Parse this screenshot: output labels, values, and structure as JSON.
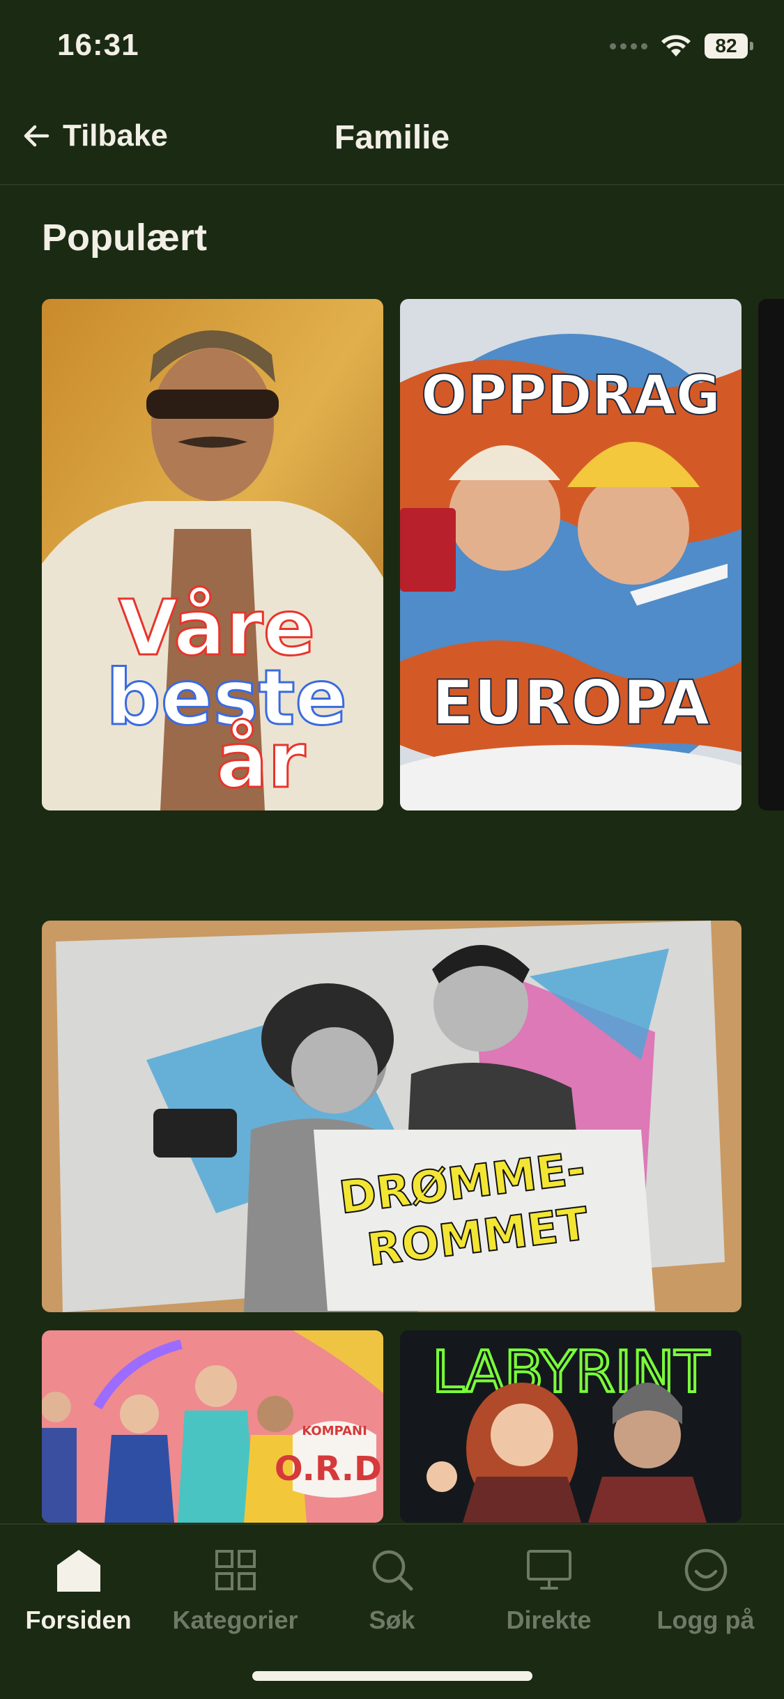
{
  "status": {
    "time": "16:31",
    "battery": "82"
  },
  "header": {
    "back_label": "Tilbake",
    "title": "Familie"
  },
  "section": {
    "title": "Populært"
  },
  "cards": {
    "vare_beste_ar": {
      "line1": "Våre",
      "line2": "beste",
      "line3": "år"
    },
    "oppdrag_europa": {
      "line1": "OPPDRAG",
      "line2": "EUROPA"
    },
    "drommerommet": {
      "line1": "DRØMME-",
      "line2": "ROMMET"
    },
    "kompani_ord": {
      "top": "KOMPANI",
      "bottom": "O.R.D."
    },
    "labyrint": {
      "title": "LABYRINT"
    }
  },
  "bottom_nav": [
    {
      "label": "Forsiden",
      "icon": "home-icon",
      "active": true
    },
    {
      "label": "Kategorier",
      "icon": "grid-icon",
      "active": false
    },
    {
      "label": "Søk",
      "icon": "search-icon",
      "active": false
    },
    {
      "label": "Direkte",
      "icon": "tv-icon",
      "active": false
    },
    {
      "label": "Logg på",
      "icon": "smile-icon",
      "active": false
    }
  ],
  "colors": {
    "background": "#1b2a13",
    "text": "#f2efe6",
    "inactive": "#6f7a66"
  }
}
